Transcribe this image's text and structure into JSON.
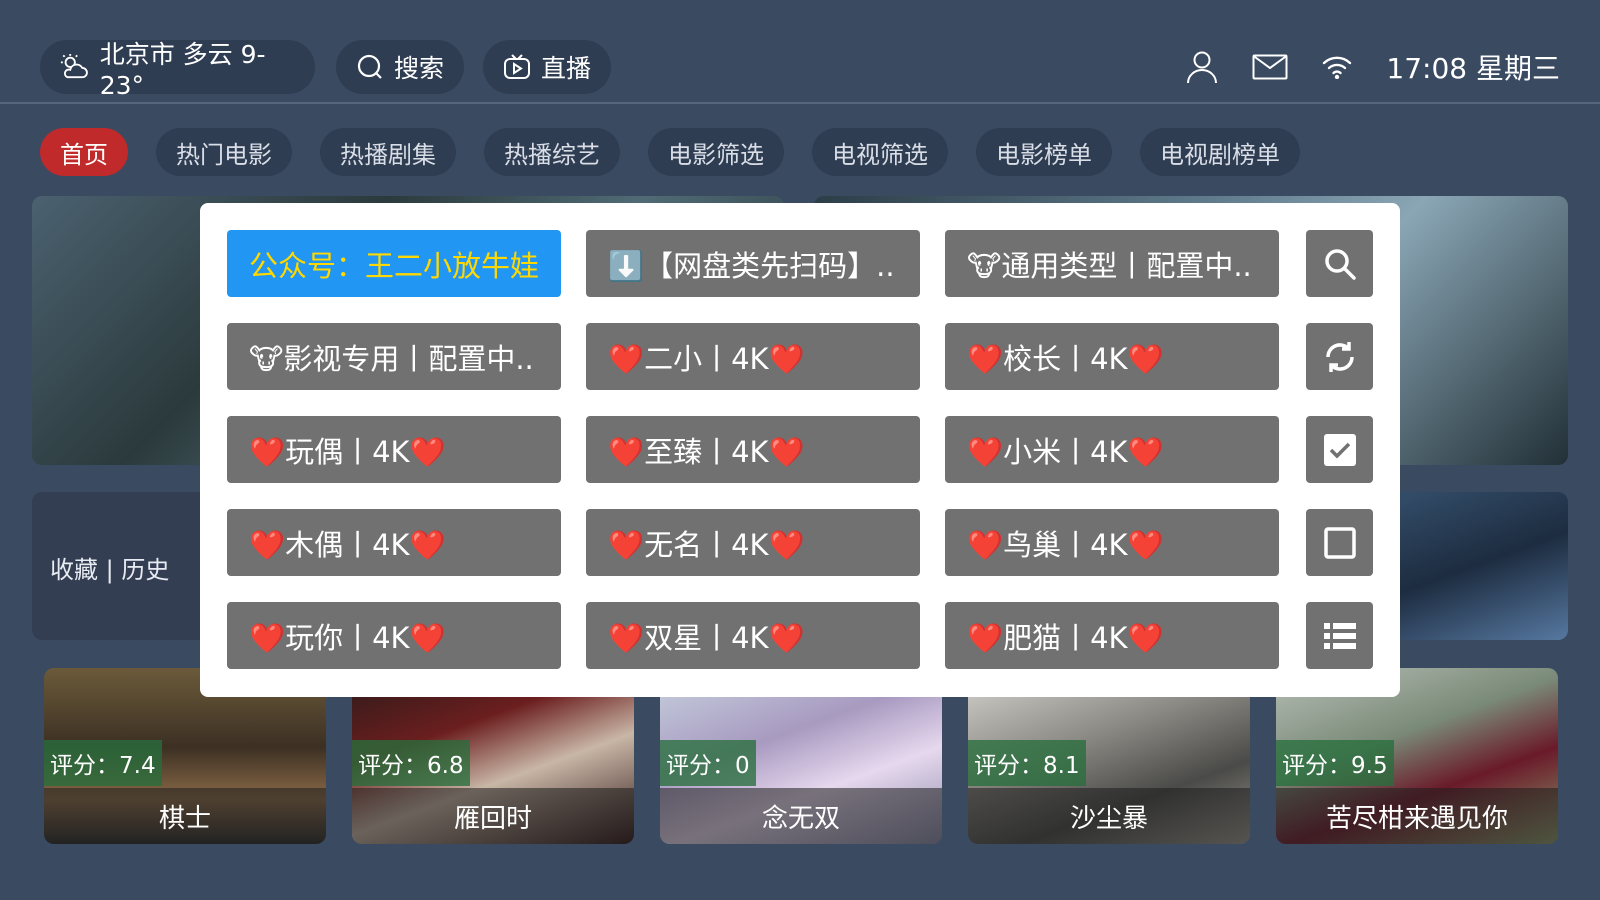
{
  "topbar": {
    "weather": "北京市 多云 9-23°",
    "search": "搜索",
    "live": "直播",
    "time": "17:08 星期三"
  },
  "tabs": [
    "首页",
    "热门电影",
    "热播剧集",
    "热播综艺",
    "电影筛选",
    "电视筛选",
    "电影榜单",
    "电视剧榜单"
  ],
  "favorites_label": "收藏 | 历史",
  "movies": [
    {
      "score": "评分：7.4",
      "title": "棋士"
    },
    {
      "score": "评分：6.8",
      "title": "雁回时"
    },
    {
      "score": "评分：0",
      "title": "念无双"
    },
    {
      "score": "评分：8.1",
      "title": "沙尘暴"
    },
    {
      "score": "评分：9.5",
      "title": "苦尽柑来遇见你"
    }
  ],
  "dialog": {
    "sources": [
      [
        "公众号：王二小放牛娃",
        "⬇️【网盘类先扫码】..",
        "🐮通用类型丨配置中.."
      ],
      [
        "🐮影视专用丨配置中..",
        "❤️二小丨4K❤️",
        "❤️校长丨4K❤️"
      ],
      [
        "❤️玩偶丨4K❤️",
        "❤️至臻丨4K❤️",
        "❤️小米丨4K❤️"
      ],
      [
        "❤️木偶丨4K❤️",
        "❤️无名丨4K❤️",
        "❤️鸟巢丨4K❤️"
      ],
      [
        "❤️玩你丨4K❤️",
        "❤️双星丨4K❤️",
        "❤️肥猫丨4K❤️"
      ]
    ],
    "side_icons": [
      "search-icon",
      "refresh-icon",
      "checkbox-checked-icon",
      "checkbox-empty-icon",
      "list-icon"
    ]
  },
  "colors": {
    "background": "#3a4a61",
    "active_tab": "#c12a2a",
    "selected_source": "#2196f3",
    "selected_text": "#ffd800",
    "button_gray": "#717171"
  }
}
